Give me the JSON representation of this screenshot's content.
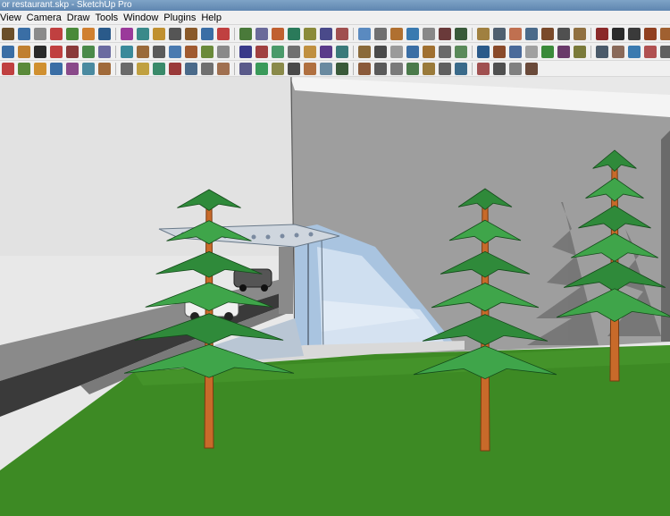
{
  "window": {
    "title": "or restaurant.skp - SketchUp Pro"
  },
  "menu": [
    "View",
    "Camera",
    "Draw",
    "Tools",
    "Window",
    "Plugins",
    "Help"
  ],
  "toolbars": {
    "row1": [
      "#6b4f2a",
      "#3a6ea5",
      "#8a8a8a",
      "#c04040",
      "#4a8a3a",
      "#d08030",
      "#2a5a8a",
      "#9a3a9a",
      "#3a8a8a",
      "#c09030",
      "#555555",
      "#8a5a2a",
      "#3a6ea5",
      "#c04040",
      "#4a7a3a",
      "#6a6a9a",
      "#c06030",
      "#2a7a5a",
      "#8a8a3a",
      "#4a4a8a",
      "#a05050",
      "#5a8ac0",
      "#707070",
      "#b07030",
      "#3a7ab0",
      "#888888",
      "#6a3a3a",
      "#3a5a3a",
      "#a08040",
      "#506070",
      "#c07050",
      "#4a6a8a",
      "#7a4a2a",
      "#505050",
      "#907040",
      "#8a2a2a",
      "#2a2a2a",
      "#3a3a3a",
      "#904020",
      "#a06030",
      "#603010",
      "#4a4a4a",
      "#705030",
      "#502010"
    ],
    "row2": [
      "#3a6ea5",
      "#c08030",
      "#2a2a2a",
      "#c04040",
      "#8a3a3a",
      "#4a8a4a",
      "#6a6aa0",
      "#3a8a9a",
      "#9a6a3a",
      "#5a5a5a",
      "#4a7ab0",
      "#a05a30",
      "#6a8a3a",
      "#8a8a8a",
      "#3a3a8a",
      "#a04040",
      "#4a9a6a",
      "#707070",
      "#c09040",
      "#5a3a8a",
      "#3a7a7a",
      "#8a6a3a",
      "#4a4a4a",
      "#9a9a9a",
      "#3a6ea5",
      "#a07030",
      "#6a6a6a",
      "#5a8a5a",
      "#2a5a8a",
      "#8a4a2a",
      "#4a6a9a",
      "#a0a0a0",
      "#3a8a3a",
      "#6a3a6a",
      "#7a7a3a",
      "#4a5a6a",
      "#8a6a5a",
      "#3a7ab0",
      "#b05050",
      "#606060"
    ],
    "row3": [
      "#c04040",
      "#5a8a3a",
      "#d09030",
      "#3a6ea5",
      "#8a4a8a",
      "#4a8aa0",
      "#a06a3a",
      "#6a6a6a",
      "#c0a040",
      "#3a8a6a",
      "#9a3a3a",
      "#4a6a8a",
      "#707070",
      "#a07050",
      "#5a5a8a",
      "#3a9a5a",
      "#8a8a4a",
      "#4a4a4a",
      "#b07040",
      "#6a8aa0",
      "#3a5a3a",
      "#8a5a3a",
      "#5a5a5a",
      "#7a7a7a",
      "#4a7a4a",
      "#9a7a3a",
      "#606060",
      "#3a6a8a",
      "#a05050",
      "#505050",
      "#808080",
      "#6a4a3a"
    ]
  },
  "scene": {
    "sky_color": "#e6e6e6",
    "grass_color": "#3d8a24",
    "wall_color": "#9a9a9a",
    "road_color": "#3a3a3a"
  }
}
